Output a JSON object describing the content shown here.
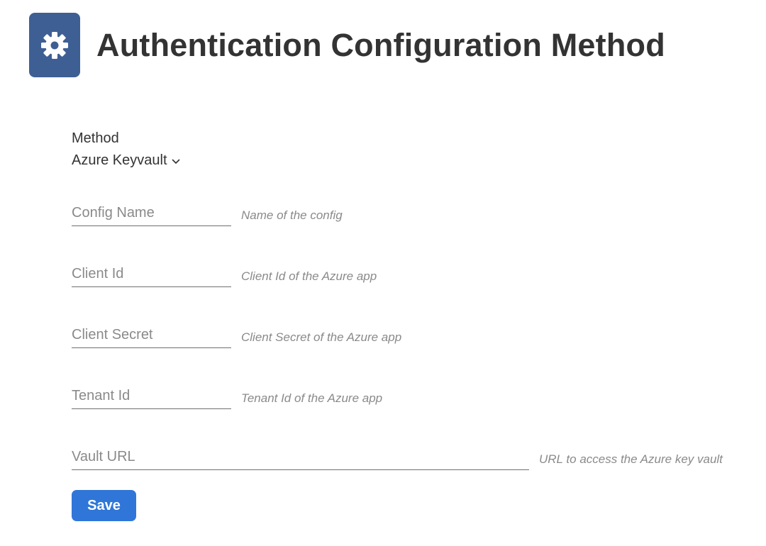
{
  "header": {
    "icon": "gear-icon",
    "title": "Authentication Configuration Method",
    "icon_bg_color": "#3e5f94"
  },
  "method": {
    "label": "Method",
    "selected": "Azure Keyvault",
    "icon": "chevron-down-icon"
  },
  "fields": {
    "config_name": {
      "placeholder": "Config Name",
      "value": "",
      "hint": "Name of the config"
    },
    "client_id": {
      "placeholder": "Client Id",
      "value": "",
      "hint": "Client Id of the Azure app"
    },
    "client_secret": {
      "placeholder": "Client Secret",
      "value": "",
      "hint": "Client Secret of the Azure app"
    },
    "tenant_id": {
      "placeholder": "Tenant Id",
      "value": "",
      "hint": "Tenant Id of the Azure app"
    },
    "vault_url": {
      "placeholder": "Vault URL",
      "value": "",
      "hint": "URL to access the Azure key vault"
    }
  },
  "actions": {
    "save_label": "Save",
    "save_color": "#2f76d8"
  }
}
